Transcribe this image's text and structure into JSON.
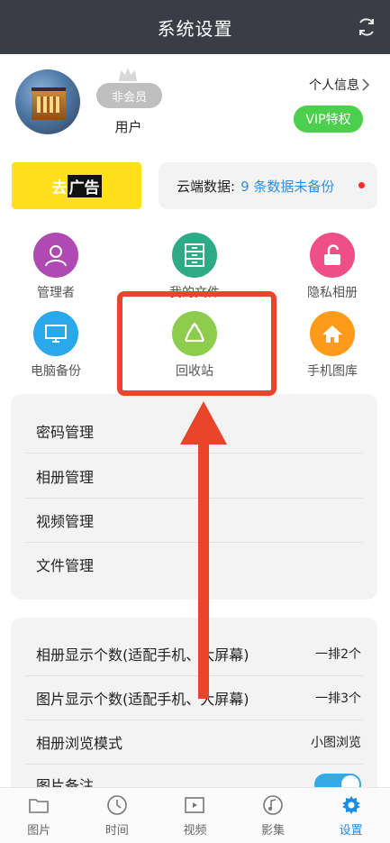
{
  "header": {
    "title": "系统设置",
    "sync_icon": "sync-icon"
  },
  "profile": {
    "member_badge": "非会员",
    "username": "用户",
    "personal_info": "个人信息",
    "vip_label": "VIP特权"
  },
  "ad": {
    "prefix": "去",
    "highlight": "广告"
  },
  "cloud": {
    "label": "云端数据:",
    "count_text": "9 条数据未备份"
  },
  "features": [
    {
      "label": "管理者",
      "color": "#b04ab2",
      "icon": "user-icon"
    },
    {
      "label": "我的文件",
      "color": "#2eaa86",
      "icon": "file-cabinet-icon"
    },
    {
      "label": "隐私相册",
      "color": "#ee4f86",
      "icon": "unlock-icon"
    },
    {
      "label": "电脑备份",
      "color": "#2aa8ec",
      "icon": "monitor-icon"
    },
    {
      "label": "回收站",
      "color": "#8dcc4c",
      "icon": "recycle-icon"
    },
    {
      "label": "手机图库",
      "color": "#ff9a1a",
      "icon": "home-icon"
    }
  ],
  "manage_list": [
    "密码管理",
    "相册管理",
    "视频管理",
    "文件管理"
  ],
  "display_list": [
    {
      "label": "相册显示个数(适配手机、大屏幕)",
      "value": "一排2个"
    },
    {
      "label": "图片显示个数(适配手机、大屏幕)",
      "value": "一排3个"
    },
    {
      "label": "相册浏览模式",
      "value": "小图浏览"
    },
    {
      "label": "图片备注",
      "value": ""
    }
  ],
  "tabs": [
    {
      "label": "图片",
      "icon": "folder-icon",
      "active": false
    },
    {
      "label": "时间",
      "icon": "clock-icon",
      "active": false
    },
    {
      "label": "视频",
      "icon": "video-icon",
      "active": false
    },
    {
      "label": "影集",
      "icon": "music-icon",
      "active": false
    },
    {
      "label": "设置",
      "icon": "gear-icon",
      "active": true
    }
  ],
  "colors": {
    "accent": "#1a8de8",
    "highlight": "#e8452c",
    "vip": "#4ccf4c"
  }
}
